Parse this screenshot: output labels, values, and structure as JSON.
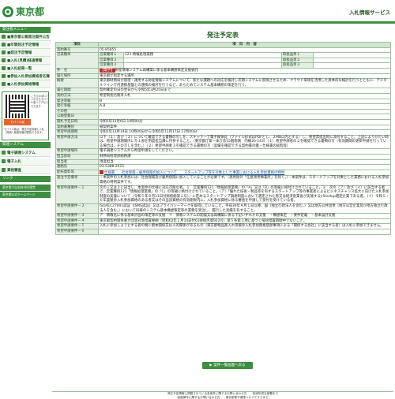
{
  "header": {
    "logo_text": "東京都",
    "site_title": "入札情報サービス"
  },
  "sidebar": {
    "menu_head": "発注者メニュー",
    "items": [
      {
        "label": "■東京都公報発注案件公告"
      },
      {
        "label": "■年間発注予定情報"
      },
      {
        "label": "■発注予定情報"
      },
      {
        "label": "■入札(見積)経過情報"
      },
      {
        "label": "■入札結果一覧"
      },
      {
        "label": "■参加入札参加資格者名簿"
      },
      {
        "label": "■入札参加資格情報"
      }
    ],
    "notice_text": "こちらのQRコードからもモバイル版へアクセスできます",
    "mobile_badge": "モバイル版",
    "mobile_text": "モバイル版は、発注予定情報と入札（見積）経過情報が閲覧できます。",
    "system_head": "関連システム",
    "system_items": [
      {
        "label": "電子調達システム"
      },
      {
        "label": "電子入札"
      },
      {
        "label": "資格審査"
      }
    ],
    "links_head": "リンク",
    "links": [
      {
        "label": "東京電子自治体共同運営"
      },
      {
        "label": "東京都公式ホームページ"
      }
    ]
  },
  "main": {
    "title": "発注予定表",
    "table_header": {
      "col1": "項目",
      "col2": "項　目　内　容"
    },
    "rows": {
      "contract_no": {
        "label": "契約番号",
        "value": "05-85855"
      },
      "business_items": {
        "label": "営業種目",
        "items": [
          {
            "name": "営業種目１",
            "value": "121 情報処理業務",
            "group": "取扱品目１"
          },
          {
            "name": "営業種目２",
            "value": "",
            "group": "取扱品目２"
          },
          {
            "name": "営業種目３",
            "value": "",
            "group": "取扱品目３"
          }
        ]
      },
      "subject": {
        "label": "件　名",
        "tag": "【電子】",
        "value": "財産情報システム再構築に係る基本構想策定支援委託"
      },
      "place": {
        "label": "履行場所",
        "value": "東京都が指定する場所"
      },
      "summary": {
        "label": "概要",
        "value": "東京都財務局が管理・運用する財産情報システムについて、新たな課題への対応を検討し次期システムに反映させるため、クラウド環境を活用した具体的な検討を行うとともに、デジタルツイン庁内連携基盤との連携の検討を行うなど、あらためてシステム基本構想の策定を行う。"
      },
      "period": {
        "label": "履行期間",
        "value": "契約確定の日の翌日から令和5年3月25日まで"
      },
      "contract_method": {
        "label": "契約方法",
        "value": "希望制指名競争入札"
      },
      "department": {
        "label": "発注等級",
        "value": "B"
      },
      "grade": {
        "label": "発行等級",
        "value": "A,B"
      },
      "other": {
        "label": "その他",
        "value": ""
      },
      "public_date": {
        "label": "公報登載日",
        "value": ""
      },
      "open_date": {
        "label": "開札予定日時",
        "value": "令和5年12月6日 10時00分"
      },
      "contract_type": {
        "label": "契約書種別",
        "value": "紙契約案件"
      },
      "apply_period": {
        "label": "希望申請期間",
        "value": "令和5年11月14日 10時00分から令和5年11月17日 17時00分"
      },
      "apply_method": {
        "label": "希望申請方法",
        "value": "以下（１）及び（２）について確認できる書類の写しを、スキャナーで電子媒体化（ファイル形式はPDFとし、２MB以内とする）し、希望票提出時に添付すること。上記によりがたい時は、希望申請期間内に写１部を用度担当課に持参すること。（東京都庁第一本庁舎15階南側　内線26-143）（１）希望申請者の２を確認できる書類の写（有効期間の更新申請を行っている場合は、その写しを含む。）（２）希望申請者３を確認できる書類の写（実績を確認できる契約書の鑑・仕様書の抜粋等）"
      },
      "apply_place": {
        "label": "希望申請場所",
        "value": "電子調達システムから希望申請をしてください。"
      },
      "contact": {
        "label": "担当部局",
        "value": "財務局経理部総務課"
      },
      "contact_staff": {
        "label": "担当者",
        "value": "用度担当"
      },
      "phone": {
        "label": "連絡先",
        "value": "03-5388-2615"
      },
      "attachments": {
        "label": "配布資料等",
        "value": "仕様書　　社会保険・雇用保険の加入について　　スタートアップ等を対象とした事業における入札参加資格の特例"
      },
      "tender_note": {
        "label": "発注予定備考",
        "value": "・本案件の入札参加には、社会保険及び雇用保険に加入していることが必要です。（適用除外「任意適用事業所」を除く。）・本案件は、スタートアップを対象とした業務における入札参加資格の特例案件です。"
      },
      "req1": {
        "label": "希望申請要件－１",
        "value": "次の１又は２に該当し、本案件の仕様に対応可能な者。１　営業種目121「情報処理業務」の「A」又は「B」の等級に格付けされていること。２　次の（ア）及び（イ）に該当する者で、営業種目121「情報処理業務」の「C」の等級に格付けされていること。（ア）「優れた技術・製品等を有するスタートアップ等の事業者によるビジネスチャンス拡大に向けた入札参加制度の実施について（令和５年９月11日付財経総第１号）」に定めるスタートアップ調達制度において選定された者又は経済産業省が実施するJ-Startup選定企業である者。（イ）令和５・６年度競争入札参加資格のある者又はその当該資格の有効期限内に、入札参加資格に係る審査を申請して受付を受けている者。"
      },
      "req2": {
        "label": "希望申請要件－２",
        "value": "ISO/IEC27001認証（ISMS認証）又はプライバシーマークを取得していること。平成30年４月１日以降、国（独立行政法人を含む。）又は地方公共団体（地方公営企業及び地方独立行政法人を含む。）において同様のシステム基本構想策定等の業務を受注し、履行した実績を有すること。"
      },
      "req3": {
        "label": "希望申請要件－３",
        "value": "ア　情報化に係る基本計画の策定等の支援　イ　情報システムの開発又は再構築に係る下記いずれかの支援　・構想策定　・要件定義　・基本設計支援"
      },
      "req4": {
        "label": "希望申請要件－４",
        "value": "東京都契約関係暴力団等対策措置要綱（昭和62年１月14日付61財経庶第922号）第５条第１項に基づく排除措置期間中でないこと。"
      },
      "req5": {
        "label": "希望申請要件－５",
        "value": "入札に参加しようとする者の間に資本関係又は人的関係があるもの（東京都物品買入れ等競争入札参加資格登録事項による「関係する会社」に該当する者）は入札に参加できません。"
      },
      "req6": {
        "label": "希望申請要件－６",
        "value": ""
      }
    },
    "back_button": "▶ 案件一覧画面へ戻る"
  },
  "footer": {
    "line1": "発注予定情報に掲載されている各案件に関するお問い合わせ先　　各局所担当部署まで",
    "line2": "画面操作に関するお問い合わせ先　　東京都電子調達ヘルプデスクまで"
  }
}
